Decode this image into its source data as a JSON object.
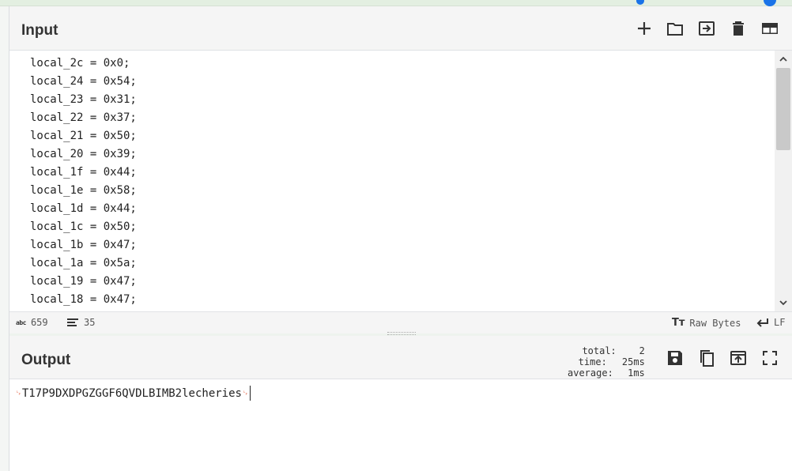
{
  "input": {
    "title": "Input",
    "toolbar": [
      "add-icon",
      "open-folder-icon",
      "import-icon",
      "delete-icon",
      "layout-icon"
    ],
    "lines": [
      "local_2c = 0x0;",
      "local_24 = 0x54;",
      "local_23 = 0x31;",
      "local_22 = 0x37;",
      "local_21 = 0x50;",
      "local_20 = 0x39;",
      "local_1f = 0x44;",
      "local_1e = 0x58;",
      "local_1d = 0x44;",
      "local_1c = 0x50;",
      "local_1b = 0x47;",
      "local_1a = 0x5a;",
      "local_19 = 0x47;",
      "local_18 = 0x47;"
    ],
    "status": {
      "chars_icon_text": "abc",
      "chars": "659",
      "lines": "35",
      "encoding": "Raw Bytes",
      "eol": "LF"
    }
  },
  "output": {
    "title": "Output",
    "stats": {
      "total_label": "total:",
      "total_value": "2",
      "time_label": "time:",
      "time_value": "25ms",
      "average_label": "average:",
      "average_value": "1ms"
    },
    "toolbar": [
      "save-icon",
      "copy-icon",
      "replace-input-icon",
      "maximise-icon"
    ],
    "text": "T17P9DXDPGZGGF6QVDLBIMB2lecheries",
    "control_glyph": "␊"
  },
  "colors": {
    "accent": "#1a73e8",
    "control_char": "#e05a3a",
    "header_bg": "#f5f5f5"
  }
}
